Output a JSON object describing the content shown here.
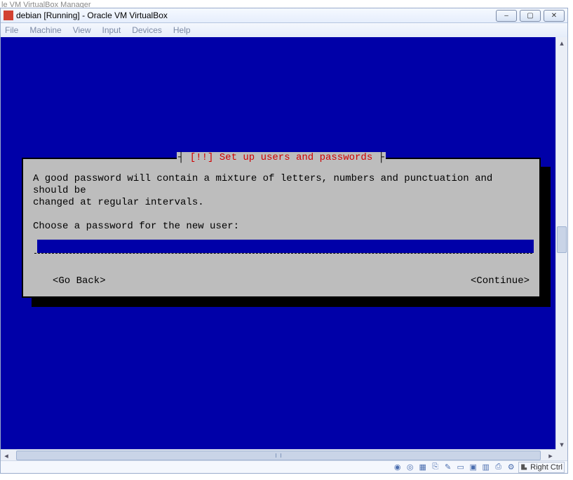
{
  "behind_window_title": "le VM VirtualBox Manager",
  "window": {
    "title": "debian [Running] - Oracle VM VirtualBox",
    "buttons": {
      "min": "–",
      "max": "▢",
      "close": "✕"
    }
  },
  "menubar": [
    "File",
    "Machine",
    "View",
    "Input",
    "Devices",
    "Help"
  ],
  "installer": {
    "title_prefix": "┤",
    "title_bang": "[!!] ",
    "title_text": "Set up users and passwords",
    "title_suffix": " ├",
    "body_line1": "A good password will contain a mixture of letters, numbers and punctuation and should be",
    "body_line2": "changed at regular intervals.",
    "prompt": "Choose a password for the new user:",
    "password_value": "",
    "go_back": "<Go Back>",
    "continue": "<Continue>"
  },
  "statusbar": {
    "host_key": "Right Ctrl",
    "icons": [
      "disk-icon",
      "optical-icon",
      "network-icon",
      "usb-icon",
      "shared-icon",
      "display-icon",
      "record-icon",
      "audio-icon",
      "clipboard-icon",
      "settings-icon"
    ]
  }
}
